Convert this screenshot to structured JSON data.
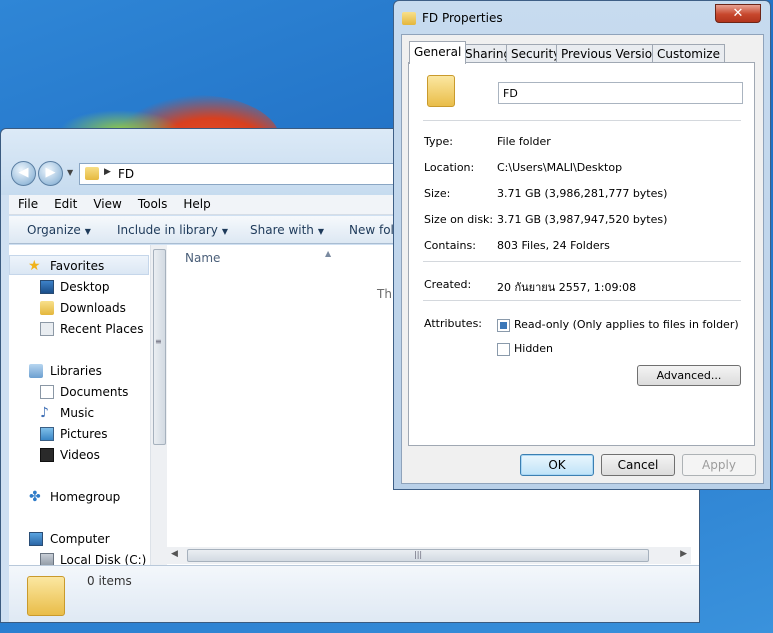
{
  "explorer": {
    "address": "FD",
    "menu": [
      "File",
      "Edit",
      "View",
      "Tools",
      "Help"
    ],
    "commands": [
      "Organize",
      "Include in library",
      "Share with",
      "New folder"
    ],
    "column_name": "Name",
    "empty_text": "Th",
    "nav": {
      "favorites": "Favorites",
      "desktop": "Desktop",
      "downloads": "Downloads",
      "recent": "Recent Places",
      "libraries": "Libraries",
      "documents": "Documents",
      "music": "Music",
      "pictures": "Pictures",
      "videos": "Videos",
      "homegroup": "Homegroup",
      "computer": "Computer",
      "local_disk": "Local Disk (C:)"
    },
    "item_count": "0 items"
  },
  "dialog": {
    "title": "FD Properties",
    "close_glyph": "✕",
    "tabs": [
      "General",
      "Sharing",
      "Security",
      "Previous Versions",
      "Customize"
    ],
    "folder_name": "FD",
    "rows": {
      "type_label": "Type:",
      "type_value": "File folder",
      "location_label": "Location:",
      "location_value": "C:\\Users\\MALI\\Desktop",
      "size_label": "Size:",
      "size_value": "3.71 GB (3,986,281,777 bytes)",
      "size_on_disk_label": "Size on disk:",
      "size_on_disk_value": "3.71 GB (3,987,947,520 bytes)",
      "contains_label": "Contains:",
      "contains_value": "803 Files, 24 Folders",
      "created_label": "Created:",
      "created_value": "20 กันยายน 2557, 1:09:08",
      "attributes_label": "Attributes:"
    },
    "attributes": {
      "readonly_label": "Read-only (Only applies to files in folder)",
      "hidden_label": "Hidden",
      "advanced_label": "Advanced..."
    },
    "buttons": {
      "ok": "OK",
      "cancel": "Cancel",
      "apply": "Apply"
    }
  }
}
